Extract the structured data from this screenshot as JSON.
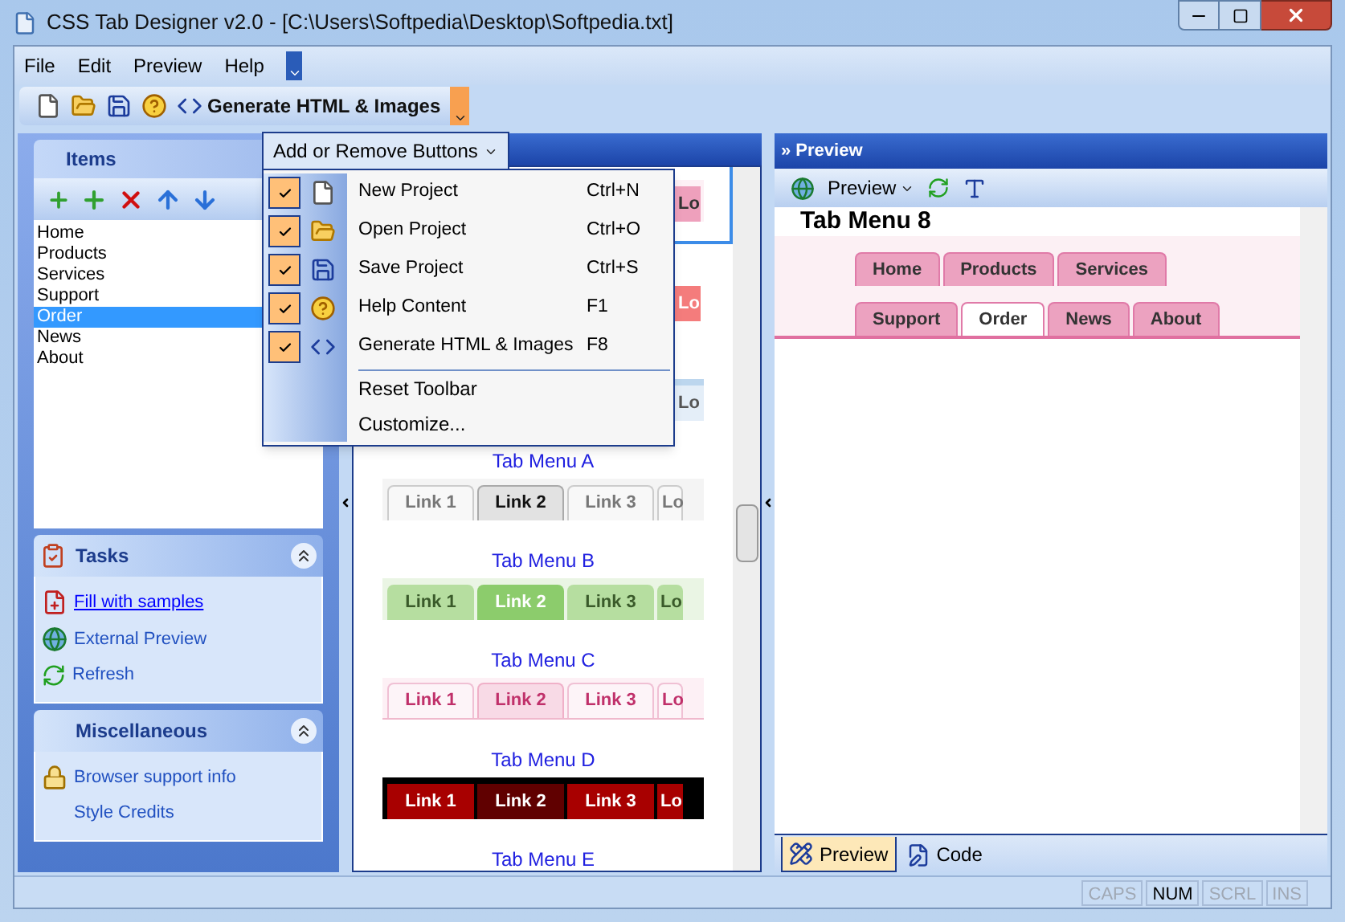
{
  "window": {
    "title": "CSS Tab Designer v2.0 - [C:\\Users\\Softpedia\\Desktop\\Softpedia.txt]"
  },
  "menu_bar": [
    "File",
    "Edit",
    "Preview",
    "Help"
  ],
  "toolbar": {
    "buttons": [
      {
        "kind": "new"
      },
      {
        "kind": "open"
      },
      {
        "kind": "save"
      },
      {
        "kind": "help"
      },
      {
        "kind": "generate",
        "label": "Generate HTML & Images"
      }
    ]
  },
  "customize_menu": {
    "button": "Add or Remove Buttons",
    "items": [
      {
        "kind": "new",
        "label": "New Project",
        "shortcut": "Ctrl+N",
        "checked": true
      },
      {
        "kind": "open",
        "label": "Open Project",
        "shortcut": "Ctrl+O",
        "checked": true
      },
      {
        "kind": "save",
        "label": "Save Project",
        "shortcut": "Ctrl+S",
        "checked": true
      },
      {
        "kind": "help",
        "label": "Help Content",
        "shortcut": "F1",
        "checked": true
      },
      {
        "kind": "generate",
        "label": "Generate HTML & Images",
        "shortcut": "F8",
        "checked": true
      }
    ],
    "extras": [
      "Reset Toolbar",
      "Customize..."
    ]
  },
  "items_panel": {
    "title": "Items",
    "tools": [
      {
        "kind": "add_many"
      },
      {
        "kind": "add"
      },
      {
        "kind": "delete"
      },
      {
        "kind": "up"
      },
      {
        "kind": "down"
      }
    ],
    "items": [
      {
        "label": "Home",
        "selected": false
      },
      {
        "label": "Products",
        "selected": false
      },
      {
        "label": "Services",
        "selected": false
      },
      {
        "label": "Support",
        "selected": false
      },
      {
        "label": "Order",
        "selected": true
      },
      {
        "label": "News",
        "selected": false
      },
      {
        "label": "About",
        "selected": false
      }
    ]
  },
  "tasks_panel": {
    "title": "Tasks",
    "links": [
      {
        "kind": "samples",
        "label": "Fill with samples",
        "hovered": true
      },
      {
        "kind": "globe",
        "label": "External Preview",
        "hovered": false
      },
      {
        "kind": "refresh",
        "label": "Refresh",
        "hovered": false
      }
    ]
  },
  "misc_panel": {
    "title": "Miscellaneous",
    "links": [
      {
        "kind": "info",
        "label": "Browser support info",
        "hovered": false
      },
      {
        "kind": "plain",
        "label": "Style Credits",
        "hovered": false
      }
    ]
  },
  "styles_list": {
    "items": [
      {
        "kind": "pink",
        "selected": true,
        "tabs": [
          {
            "label": "Lo"
          }
        ]
      },
      {
        "kind": "red",
        "selected": false,
        "tabs": [
          {
            "label": "Lo"
          }
        ]
      },
      {
        "kind": "blue",
        "selected": false,
        "tabs": [
          {
            "label": "Lo"
          }
        ]
      },
      {
        "kind": "gray",
        "label": "Tab Menu A",
        "selected": false,
        "tabs": [
          {
            "label": "Link 1",
            "selected": false
          },
          {
            "label": "Link 2",
            "selected": true
          },
          {
            "label": "Link 3",
            "selected": false
          },
          {
            "label": "Lo",
            "selected": false
          }
        ]
      },
      {
        "kind": "green",
        "label": "Tab Menu B",
        "selected": false,
        "tabs": [
          {
            "label": "Link 1",
            "selected": false
          },
          {
            "label": "Link 2",
            "selected": true
          },
          {
            "label": "Link 3",
            "selected": false
          },
          {
            "label": "Lo",
            "selected": false
          }
        ]
      },
      {
        "kind": "rose",
        "label": "Tab Menu C",
        "selected": false,
        "tabs": [
          {
            "label": "Link 1",
            "selected": false
          },
          {
            "label": "Link 2",
            "selected": true
          },
          {
            "label": "Link 3",
            "selected": false
          },
          {
            "label": "Lo",
            "selected": false
          }
        ]
      },
      {
        "kind": "dark",
        "label": "Tab Menu D",
        "selected": false,
        "tabs": [
          {
            "label": "Link 1",
            "selected": false
          },
          {
            "label": "Link 2",
            "selected": true
          },
          {
            "label": "Link 3",
            "selected": false
          },
          {
            "label": "Lo",
            "selected": false
          }
        ]
      },
      {
        "kind": "none",
        "label": "Tab Menu E",
        "selected": false
      }
    ]
  },
  "preview": {
    "title": "» Preview",
    "toolbar": {
      "preview_button": "Preview"
    },
    "heading": "Tab Menu 8",
    "tab_rows": [
      {
        "tabs": [
          {
            "label": "Home",
            "selected": false
          },
          {
            "label": "Products",
            "selected": false
          },
          {
            "label": "Services",
            "selected": false
          }
        ]
      },
      {
        "tabs": [
          {
            "label": "Support",
            "selected": false
          },
          {
            "label": "Order",
            "selected": true
          },
          {
            "label": "News",
            "selected": false
          },
          {
            "label": "About",
            "selected": false
          }
        ]
      }
    ]
  },
  "bottom_tabs": [
    {
      "kind": "ruler",
      "label": "Preview",
      "selected": true
    },
    {
      "kind": "edit",
      "label": "Code",
      "selected": false
    }
  ],
  "status_bar": [
    {
      "label": "CAPS",
      "on": false
    },
    {
      "label": "NUM",
      "on": true
    },
    {
      "label": "SCRL",
      "on": false
    },
    {
      "label": "INS",
      "on": false
    }
  ]
}
